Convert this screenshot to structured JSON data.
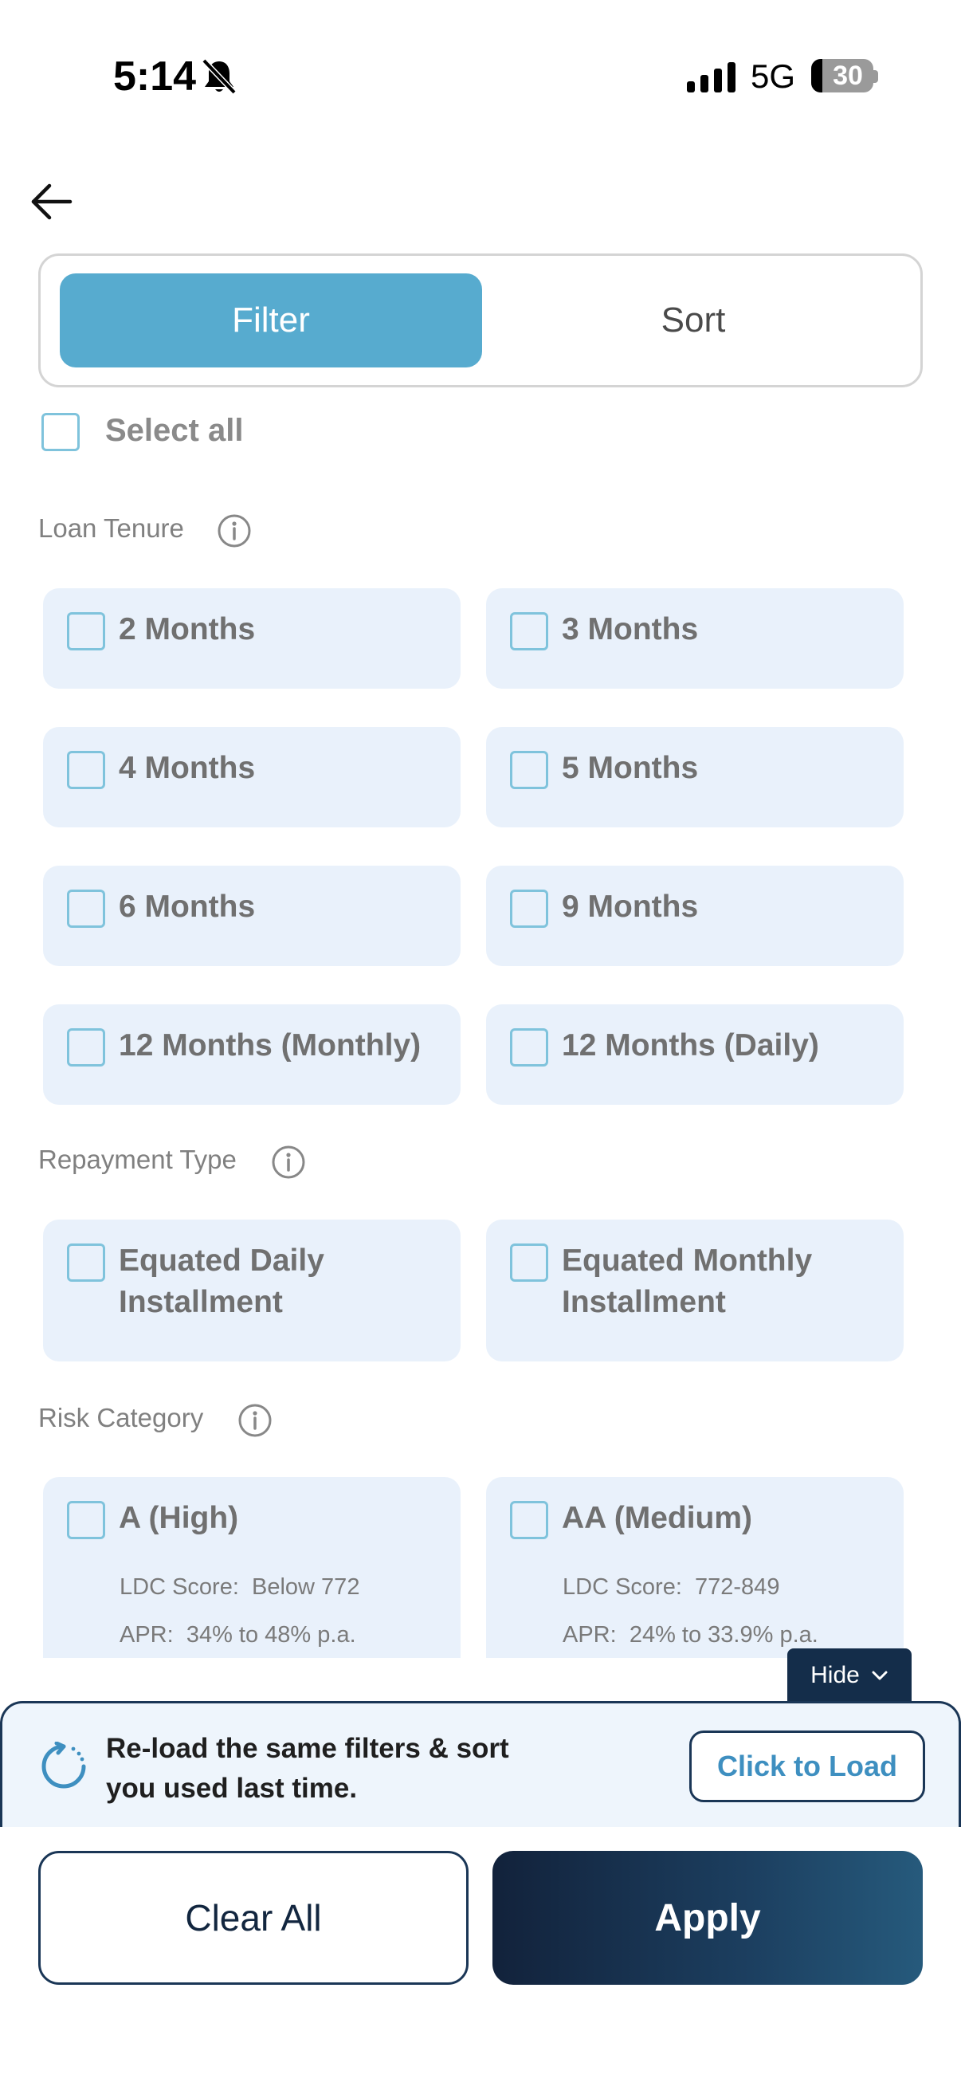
{
  "status": {
    "time": "5:14",
    "network": "5G",
    "battery": "30"
  },
  "tabs": {
    "filter": "Filter",
    "sort": "Sort"
  },
  "select_all": "Select all",
  "sections": {
    "loan_tenure": {
      "title": "Loan Tenure",
      "options": [
        "2 Months",
        "3 Months",
        "4 Months",
        "5 Months",
        "6 Months",
        "9 Months",
        "12 Months (Monthly)",
        "12 Months (Daily)"
      ]
    },
    "repayment_type": {
      "title": "Repayment Type",
      "options": [
        "Equated Daily Installment",
        "Equated Monthly Installment"
      ]
    },
    "risk_category": {
      "title": "Risk Category",
      "options": [
        {
          "label": "A (High)",
          "score_label": "LDC Score:",
          "score": "Below 772",
          "apr_label": "APR:",
          "apr": "34% to 48% p.a."
        },
        {
          "label": "AA (Medium)",
          "score_label": "LDC Score:",
          "score": "772-849",
          "apr_label": "APR:",
          "apr": "24% to 33.9% p.a."
        }
      ]
    }
  },
  "hide_label": "Hide",
  "reload": {
    "text": "Re-load the same filters & sort you used last time.",
    "button": "Click to Load"
  },
  "actions": {
    "clear": "Clear All",
    "apply": "Apply"
  }
}
